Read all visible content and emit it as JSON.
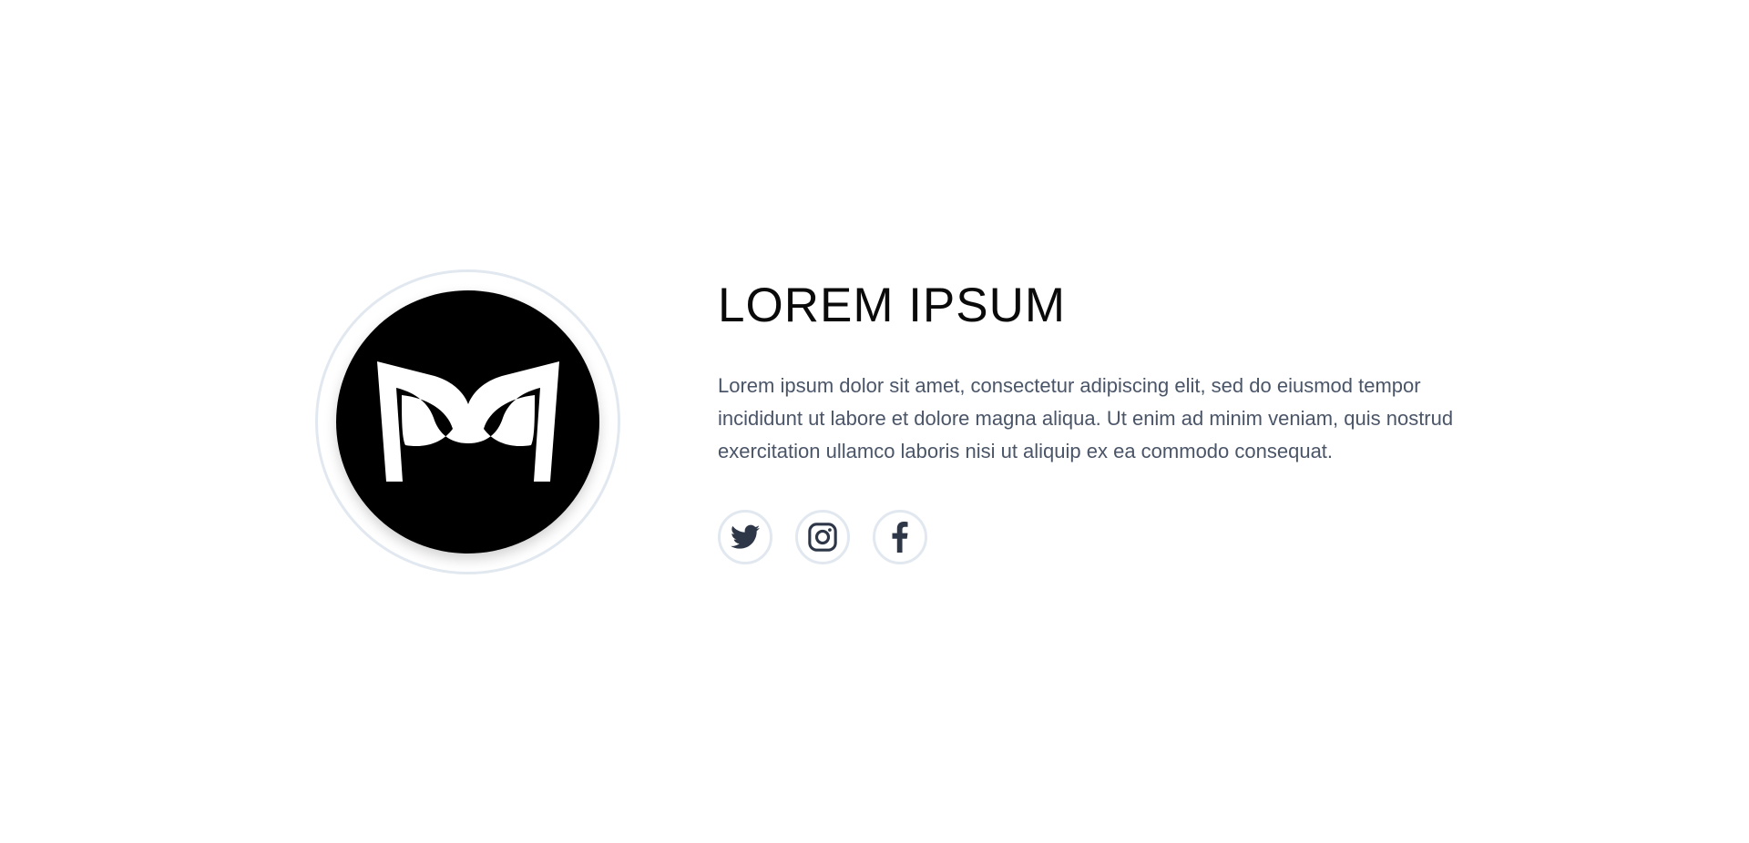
{
  "profile": {
    "title": "LOREM IPSUM",
    "description": "Lorem ipsum dolor sit amet, consectetur adipiscing elit, sed do eiusmod tempor incididunt ut labore et dolore magna aliqua. Ut enim ad minim veniam, quis nostrud exercitation ullamco laboris nisi ut aliquip ex ea commodo consequat."
  },
  "logo": {
    "icon": "mask-logo-icon",
    "background_color": "#000000",
    "mark_color": "#ffffff",
    "ring_color": "#e2e8f0"
  },
  "socials": [
    {
      "name": "twitter",
      "icon": "twitter-icon"
    },
    {
      "name": "instagram",
      "icon": "instagram-icon"
    },
    {
      "name": "facebook",
      "icon": "facebook-icon"
    }
  ],
  "colors": {
    "title": "#0a0a0a",
    "body_text": "#4a5568",
    "icon": "#2d3748",
    "border": "#e2e8f0"
  }
}
